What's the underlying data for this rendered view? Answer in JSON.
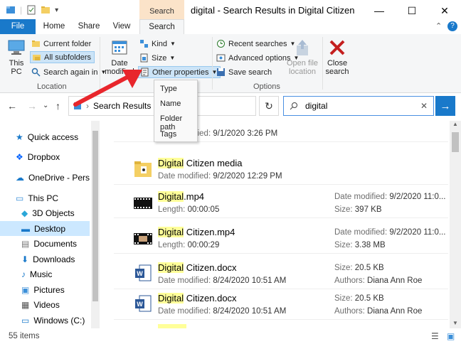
{
  "window": {
    "title": "digital - Search Results in Digital Citizen",
    "tool_tab_caption": "Search Tools",
    "controls": {
      "minimize": "—",
      "maximize": "☐",
      "close": "✕"
    }
  },
  "ribbon_tabs": [
    "File",
    "Home",
    "Share",
    "View",
    "Search"
  ],
  "ribbon": {
    "location": {
      "this_pc": "This PC",
      "current_folder": "Current folder",
      "all_subfolders": "All subfolders",
      "search_again_in": "Search again in",
      "group_label": "Location"
    },
    "refine": {
      "date_modified": "Date modified",
      "kind": "Kind",
      "size": "Size",
      "other_properties": "Other properties"
    },
    "options": {
      "recent_searches": "Recent searches",
      "advanced_options": "Advanced options",
      "save_search": "Save search",
      "open_file_location": "Open file location",
      "group_label": "Options"
    },
    "close_search": "Close search"
  },
  "dropdown": [
    "Type",
    "Name",
    "Folder path",
    "Tags"
  ],
  "address": {
    "path": "Search Results",
    "search_query": "digital"
  },
  "nav": [
    {
      "label": "Quick access",
      "icon": "star-icon"
    },
    {
      "label": "Dropbox",
      "icon": "dropbox-icon"
    },
    {
      "label": "OneDrive - Person",
      "icon": "cloud-icon"
    },
    {
      "label": "This PC",
      "icon": "computer-icon"
    },
    {
      "label": "3D Objects",
      "icon": "cube-icon"
    },
    {
      "label": "Desktop",
      "icon": "desktop-icon",
      "selected": true
    },
    {
      "label": "Documents",
      "icon": "documents-icon"
    },
    {
      "label": "Downloads",
      "icon": "download-icon"
    },
    {
      "label": "Music",
      "icon": "music-icon"
    },
    {
      "label": "Pictures",
      "icon": "pictures-icon"
    },
    {
      "label": "Videos",
      "icon": "videos-icon"
    },
    {
      "label": "Windows (C:)",
      "icon": "drive-icon"
    }
  ],
  "results": [
    {
      "hl": "",
      "rest": "",
      "sub_label": "Date modified:",
      "sub_value": "9/1/2020 3:26 PM",
      "r1_label": "",
      "r1_value": "",
      "r2_label": "",
      "r2_value": "",
      "kind": "folder"
    },
    {
      "hl": "Digital",
      "rest": " Citizen media",
      "sub_label": "Date modified:",
      "sub_value": "9/2/2020 12:29 PM",
      "r1_label": "",
      "r1_value": "",
      "r2_label": "",
      "r2_value": "",
      "kind": "folder"
    },
    {
      "hl": "Digital",
      "rest": ".mp4",
      "sub_label": "Length:",
      "sub_value": "00:00:05",
      "r1_label": "Date modified:",
      "r1_value": "9/2/2020 11:0...",
      "r2_label": "Size:",
      "r2_value": "397 KB",
      "kind": "video"
    },
    {
      "hl": "Digital",
      "rest": " Citizen.mp4",
      "sub_label": "Length:",
      "sub_value": "00:00:29",
      "r1_label": "Date modified:",
      "r1_value": "9/2/2020 11:0...",
      "r2_label": "Size:",
      "r2_value": "3.38 MB",
      "kind": "video"
    },
    {
      "hl": "Digital",
      "rest": " Citizen.docx",
      "sub_label": "Date modified:",
      "sub_value": "8/24/2020 10:51 AM",
      "r1_label": "Size:",
      "r1_value": "20.5 KB",
      "r2_label": "Authors:",
      "r2_value": "Diana Ann Roe",
      "kind": "word"
    },
    {
      "hl": "Digital",
      "rest": " Citizen.docx",
      "sub_label": "Date modified:",
      "sub_value": "8/24/2020 10:51 AM",
      "r1_label": "Size:",
      "r1_value": "20.5 KB",
      "r2_label": "Authors:",
      "r2_value": "Diana Ann Roe",
      "kind": "word"
    }
  ],
  "status": {
    "item_count": "55 items"
  },
  "colors": {
    "accent": "#1979ca",
    "tool_tab": "#fbe3c9",
    "highlight": "#ffff99",
    "arrow": "#e8262c"
  }
}
